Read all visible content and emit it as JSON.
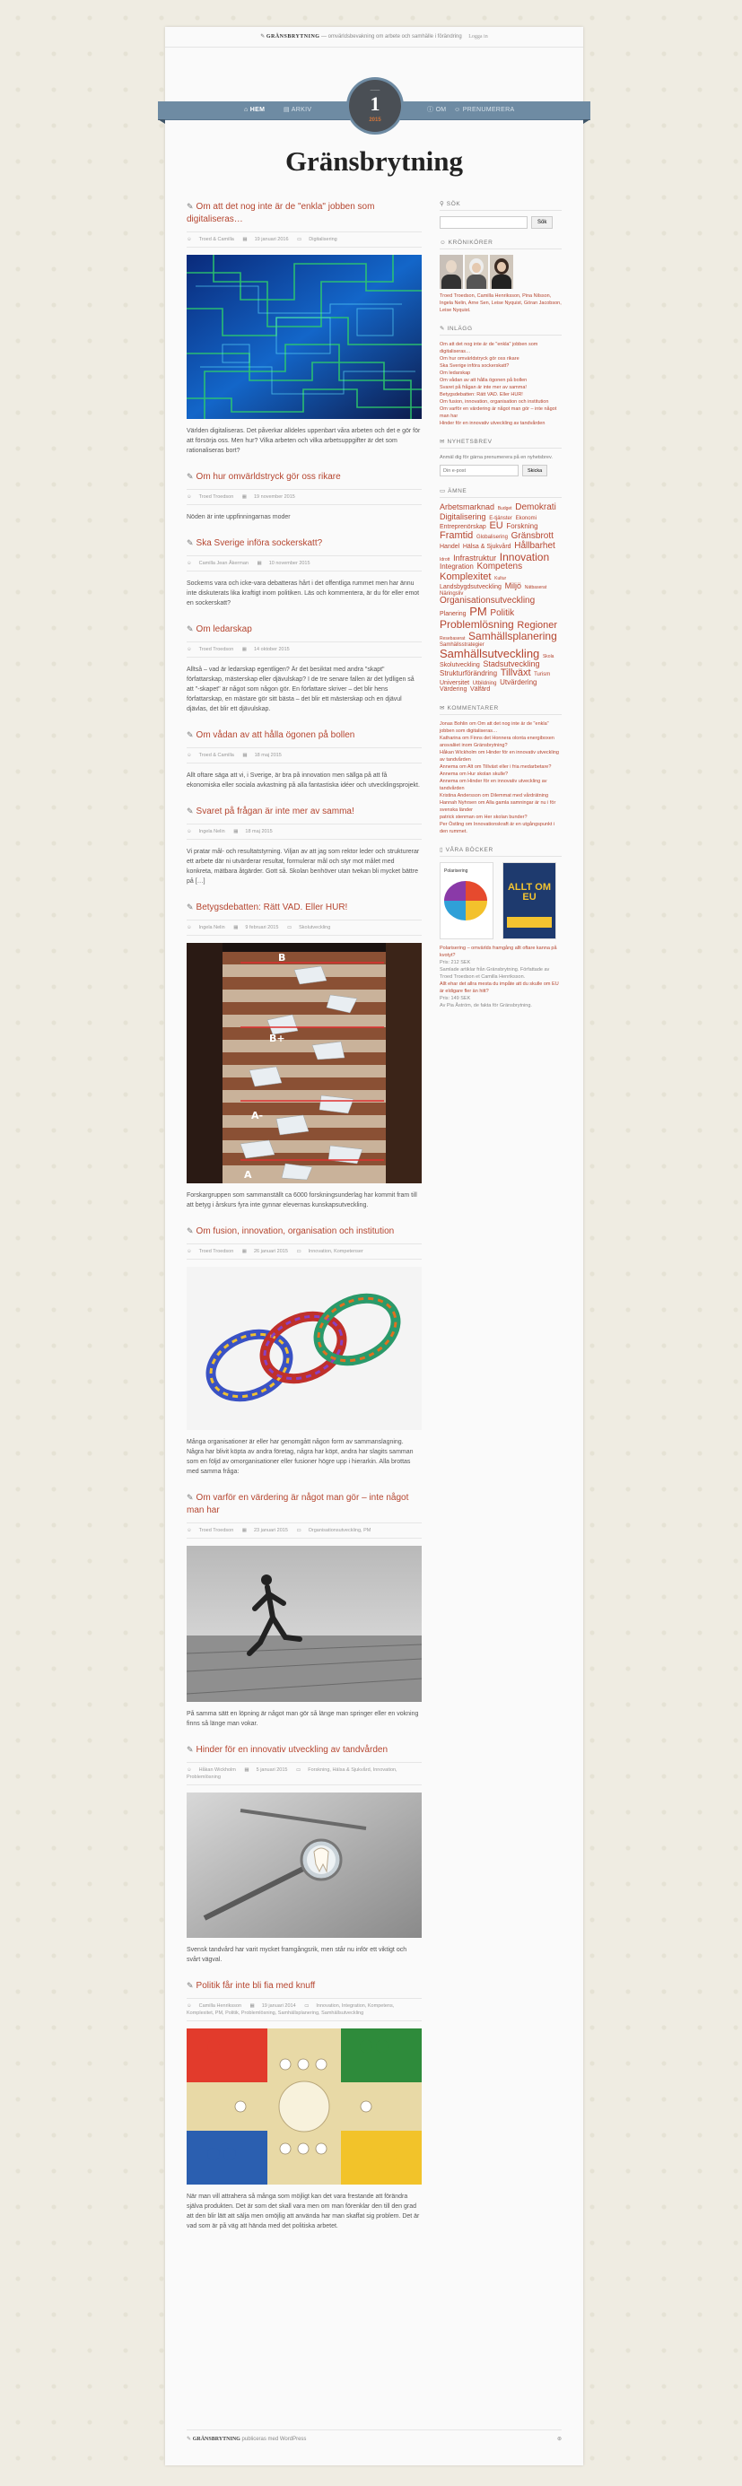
{
  "topbar": {
    "site": "GRÄNSBRYTNING",
    "tagline": "— omvärldsbevakning om arbete och samhälle i förändring",
    "login": "Logga in"
  },
  "nav": {
    "left": [
      "HEM",
      "ARKIV"
    ],
    "right": [
      "OM",
      "PRENUMERERA"
    ]
  },
  "badge": {
    "number": "1",
    "year": "2015"
  },
  "site_title": "Gränsbrytning",
  "posts": [
    {
      "title": "Om att det nog inte är de \"enkla\" jobben som digitaliseras…",
      "author": "Troed & Camilla",
      "date": "19 januari 2016",
      "cat": "Digitalisering",
      "excerpt": "Världen digitaliseras. Det påverkar alldeles uppenbart våra arbeten och det e gör för att försörja oss. Men hur? Vilka arbeten och vilka arbetsuppgifter är det som rationaliseras bort?"
    },
    {
      "title": "Om hur omvärldstryck gör oss rikare",
      "author": "Troed Troedson",
      "date": "19 november 2015",
      "cat": "",
      "excerpt": "Nöden är inte uppfinningarnas moder"
    },
    {
      "title": "Ska Sverige införa sockerskatt?",
      "author": "Camilla Jean Åkerman",
      "date": "10 november 2015",
      "cat": "",
      "excerpt": "Sockerns vara och icke-vara debatteras hårt i det offentliga rummet men har ännu inte diskuterats lika kraftigt inom politiken. Läs och kommentera, är du för eller emot en sockerskatt?"
    },
    {
      "title": "Om ledarskap",
      "author": "Troed Troedson",
      "date": "14 oktober 2015",
      "cat": "",
      "excerpt": "Alltså – vad är ledarskap egentligen? Är det besiktat med andra \"skapt\" författarskap, mästerskap eller djävulskap? I de tre senare fallen är det lydligen så att \"-skapet\" är något som någon gör. En författare skriver – det blir hens författarskap, en mästare gör sitt bästa – det blir ett mästerskap och en djävul djävlas, det blir ett djävulskap."
    },
    {
      "title": "Om vådan av att hålla ögonen på bollen",
      "author": "Troed & Camilla",
      "date": "18 maj 2015",
      "cat": "",
      "excerpt": "Allt oftare säga att vi, i Sverige, är bra på innovation men sällga på att få ekonomiska eller sociala avkastning på alla fantastiska idéer och utvecklingsprojekt."
    },
    {
      "title": "Svaret på frågan är inte mer av samma!",
      "author": "Ingela Nelin",
      "date": "18 maj 2015",
      "cat": "",
      "excerpt": "Vi pratar mål- och resultatstyrning. Viljan av att jag som rektor leder och strukturerar ett arbete där ni utvärderar resultat, formulerar mål och styr mot målet med konkreta, mätbara åtgärder. Gott så. Skolan benhöver utan tvekan bli mycket bättre på […]"
    },
    {
      "title": "Betygsdebatten: Rätt VAD. Eller HUR!",
      "author": "Ingela Nelin",
      "date": "9 februari 2015",
      "cat": "Skolutveckling",
      "excerpt": "Forskargruppen som sammanställt ca 6000 forskningsunderlag har kommit fram till att betyg i årskurs fyra inte gynnar elevernas kunskapsutveckling."
    },
    {
      "title": "Om fusion, innovation, organisation och institution",
      "author": "Troed Troedson",
      "date": "26 januari 2015",
      "cat": "Innovation, Kompetenser",
      "excerpt": "Många organisationer är eller har genomgått någon form av sammanslagning. Några har blivit köpta av andra företag, några har köpt, andra har slagits samman som en följd av omorganisationer eller fusioner högre upp i hierarkin. Alla brottas med samma fråga:"
    },
    {
      "title": "Om varför en värdering är något man gör – inte något man har",
      "author": "Troed Troedson",
      "date": "23 januari 2015",
      "cat": "Organisationsutveckling, PM",
      "excerpt": "På samma sätt en löpning är något man gör så länge man springer eller en vokning finns så länge man vokar."
    },
    {
      "title": "Hinder för en innovativ utveckling av tandvården",
      "author": "Håkan Wickholm",
      "date": "5 januari 2015",
      "cat": "Forskning, Hälsa & Sjukvård, Innovation, Problemlösning",
      "excerpt": "Svensk tandvård har varit mycket framgångsrik, men står nu inför ett viktigt och svårt vägval."
    },
    {
      "title": "Politik får inte bli fia med knuff",
      "author": "Camilla Henriksson",
      "date": "19 januari 2014",
      "cat": "Innovation, Integration, Kompetens, Komplexitet, PM, Politik, Problemlösning, Samhällsplanering, Samhällsutveckling",
      "excerpt": "När man vill attrahera så många som möjligt kan det vara frestande att förändra själva produkten. Det är som det skall vara men om man förenklar den till den grad att den blir lätt att sälja men omöjlig att använda har man skaffat sig problem. Det är vad som är på väg att hända med det politiska arbetet."
    }
  ],
  "sidebar": {
    "search": {
      "title": "SÖK",
      "placeholder": "",
      "button": "Sök"
    },
    "authors": {
      "title": "KRÖNIKÖRER",
      "names": "Troed Troedson, Camilla Henriksson, Pina Nilsson, Ingela Nelin, Arne Sen, Leise Nyquist, Göran Jacobson, Leise Nyquist."
    },
    "posts": {
      "title": "INLÄGG",
      "items": [
        "Om att det nog inte är de \"enkla\" jobben som digitaliseras…",
        "Om hur omvärldstryck gör oss rikare",
        "Ska Sverige införa sockerskatt?",
        "Om ledarskap",
        "Om vådan av att hålla ögonen på bollen",
        "Svaret på frågan är inte mer av samma!",
        "Betygsdebatten: Rätt VAD. Eller HUR!",
        "Om fusion, innovation, organisation och institution",
        "Om varför en värdering är något man gör – inte något man har",
        "Hinder för en innovativ utveckling av tandvården"
      ]
    },
    "newsletter": {
      "title": "NYHETSBREV",
      "text": "Anmäl dig för gärna prenumerera på en nyhetsbrev.",
      "placeholder": "Din e-post",
      "button": "Skicka"
    },
    "tags": {
      "title": "ÄMNE",
      "items": [
        {
          "t": "Arbetsmarknad",
          "s": 9
        },
        {
          "t": "Budget",
          "s": 5
        },
        {
          "t": "Demokrati",
          "s": 10
        },
        {
          "t": "Digitalisering",
          "s": 9
        },
        {
          "t": "E-tjänster",
          "s": 6
        },
        {
          "t": "Ekonomi",
          "s": 6
        },
        {
          "t": "Entreprenörskap",
          "s": 7
        },
        {
          "t": "EU",
          "s": 11
        },
        {
          "t": "Forskning",
          "s": 8
        },
        {
          "t": "Framtid",
          "s": 11
        },
        {
          "t": "Globalisering",
          "s": 6
        },
        {
          "t": "Gränsbrott",
          "s": 10
        },
        {
          "t": "Handel",
          "s": 7
        },
        {
          "t": "Hälsa & Sjukvård",
          "s": 7
        },
        {
          "t": "Hållbarhet",
          "s": 10
        },
        {
          "t": "Idrott",
          "s": 5
        },
        {
          "t": "Infrastruktur",
          "s": 9
        },
        {
          "t": "Innovation",
          "s": 12
        },
        {
          "t": "Integration",
          "s": 8
        },
        {
          "t": "Kompetens",
          "s": 10
        },
        {
          "t": "Komplexitet",
          "s": 11
        },
        {
          "t": "Kultur",
          "s": 5
        },
        {
          "t": "Landsbygdsutveckling",
          "s": 7
        },
        {
          "t": "Miljö",
          "s": 9
        },
        {
          "t": "Nätbaserat",
          "s": 5
        },
        {
          "t": "Näringsliv",
          "s": 6
        },
        {
          "t": "Organisationsutveckling",
          "s": 10
        },
        {
          "t": "Planering",
          "s": 7
        },
        {
          "t": "PM",
          "s": 13
        },
        {
          "t": "Politik",
          "s": 10
        },
        {
          "t": "Problemlösning",
          "s": 12
        },
        {
          "t": "Regioner",
          "s": 11
        },
        {
          "t": "Resebaserat",
          "s": 5
        },
        {
          "t": "Samhällsplanering",
          "s": 12
        },
        {
          "t": "Samhällsstrategier",
          "s": 6
        },
        {
          "t": "Samhällsutveckling",
          "s": 13
        },
        {
          "t": "Skola",
          "s": 5
        },
        {
          "t": "Skolutveckling",
          "s": 7
        },
        {
          "t": "Stadsutveckling",
          "s": 9
        },
        {
          "t": "Strukturförändring",
          "s": 8
        },
        {
          "t": "Tillväxt",
          "s": 11
        },
        {
          "t": "Turism",
          "s": 6
        },
        {
          "t": "Universitet",
          "s": 7
        },
        {
          "t": "Utbildning",
          "s": 6
        },
        {
          "t": "Utvärdering",
          "s": 8
        },
        {
          "t": "Värdering",
          "s": 7
        },
        {
          "t": "Välfärd",
          "s": 7
        }
      ]
    },
    "comments": {
      "title": "KOMMENTARER",
      "items": [
        "Jonas Bohlin om Om att det nog inte är de \"enkla\" jobben som digitaliseras…",
        "Katharina om Finns det Honnera olonta energiboxen ansvaliiet inom Gränsbrytning?",
        "Håkan Wickholm om Hinder för en innovativ utveckling av tandvården",
        "Annema om Alt om Tillväxt eller i fria medarbetare?",
        "Annema om Hur skolan skulle?",
        "Annema om Hinder för en innovativ utveckling av tandvården",
        "Kristina Andersson om Dilemmat med vårdrätning",
        "Hannah Nyhrsen om Alla gamla samningar är nu i för svenska länder",
        "patrick stenman om Her skolan bunder?",
        "Per Östling om Innovationskraft är en utgångspunkt i den rummet."
      ]
    },
    "books": {
      "title": "VÅRA BÖCKER",
      "book1_label": "Polarisering",
      "book2_label": "ALLT OM EU",
      "entries": [
        "Polarisering – omvärlds framgång allt oftare kanna på kvotyt?",
        "Pris: 212 SEK",
        "Samlade artiklar från Gränsbrytning. Författade av Troed Troedson et Camilla Henriksson.",
        "Allt ehar det allra mesta du impåte att du skulle om EU är eldigare fler än hitt?",
        "Pris: 149 SEK",
        "Av Pia Åström, de fakta för Gränsbrytning."
      ]
    }
  },
  "footer": {
    "site": "GRÄNSBRYTNING",
    "credit": "publiceras med WordPress"
  }
}
